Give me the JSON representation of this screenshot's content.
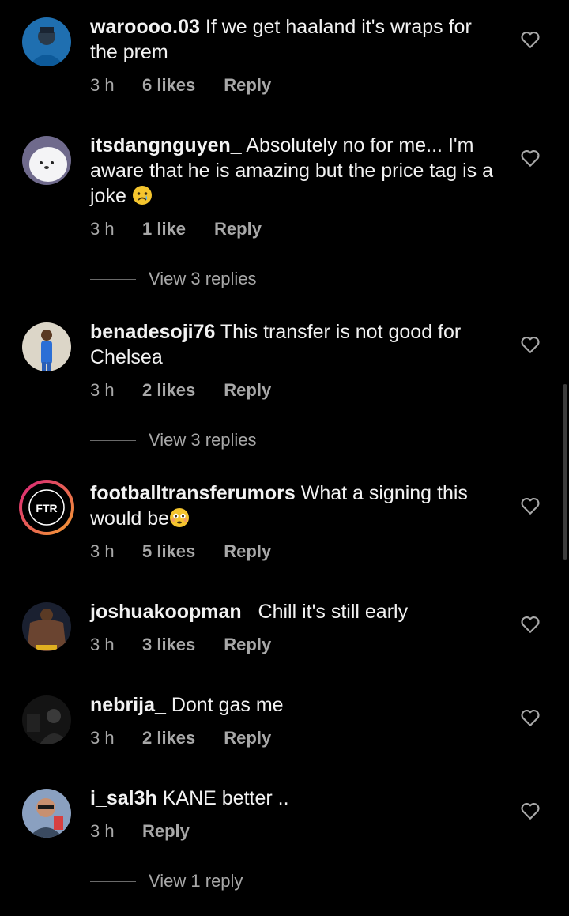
{
  "colors": {
    "background": "#000000",
    "text": "#f2f2f2",
    "muted": "#a8a8a8"
  },
  "comments": [
    {
      "username": "waroooo.03",
      "text": "If we get haaland it's wraps for the prem",
      "time": "3 h",
      "likes": "6 likes",
      "reply": "Reply"
    },
    {
      "username": "itsdangnguyen_",
      "text": "Absolutely no for me... I'm aware that he is amazing but the price tag is a joke",
      "emoji": "crying-face",
      "time": "3 h",
      "likes": "1 like",
      "reply": "Reply",
      "view_replies": "View 3 replies"
    },
    {
      "username": "benadesoji76",
      "text": "This transfer is not good for Chelsea",
      "time": "3 h",
      "likes": "2 likes",
      "reply": "Reply",
      "view_replies": "View 3 replies"
    },
    {
      "username": "footballtransferumors",
      "text": "What a signing this would be",
      "emoji": "flushed-face",
      "avatar_logo": "FTR",
      "time": "3 h",
      "likes": "5 likes",
      "reply": "Reply"
    },
    {
      "username": "joshuakoopman_",
      "text": "Chill it's still early",
      "time": "3 h",
      "likes": "3 likes",
      "reply": "Reply"
    },
    {
      "username": "nebrija_",
      "text": "Dont gas me",
      "time": "3 h",
      "likes": "2 likes",
      "reply": "Reply"
    },
    {
      "username": "i_sal3h",
      "text": "KANE better ..",
      "time": "3 h",
      "reply": "Reply",
      "view_replies": "View 1 reply"
    }
  ]
}
